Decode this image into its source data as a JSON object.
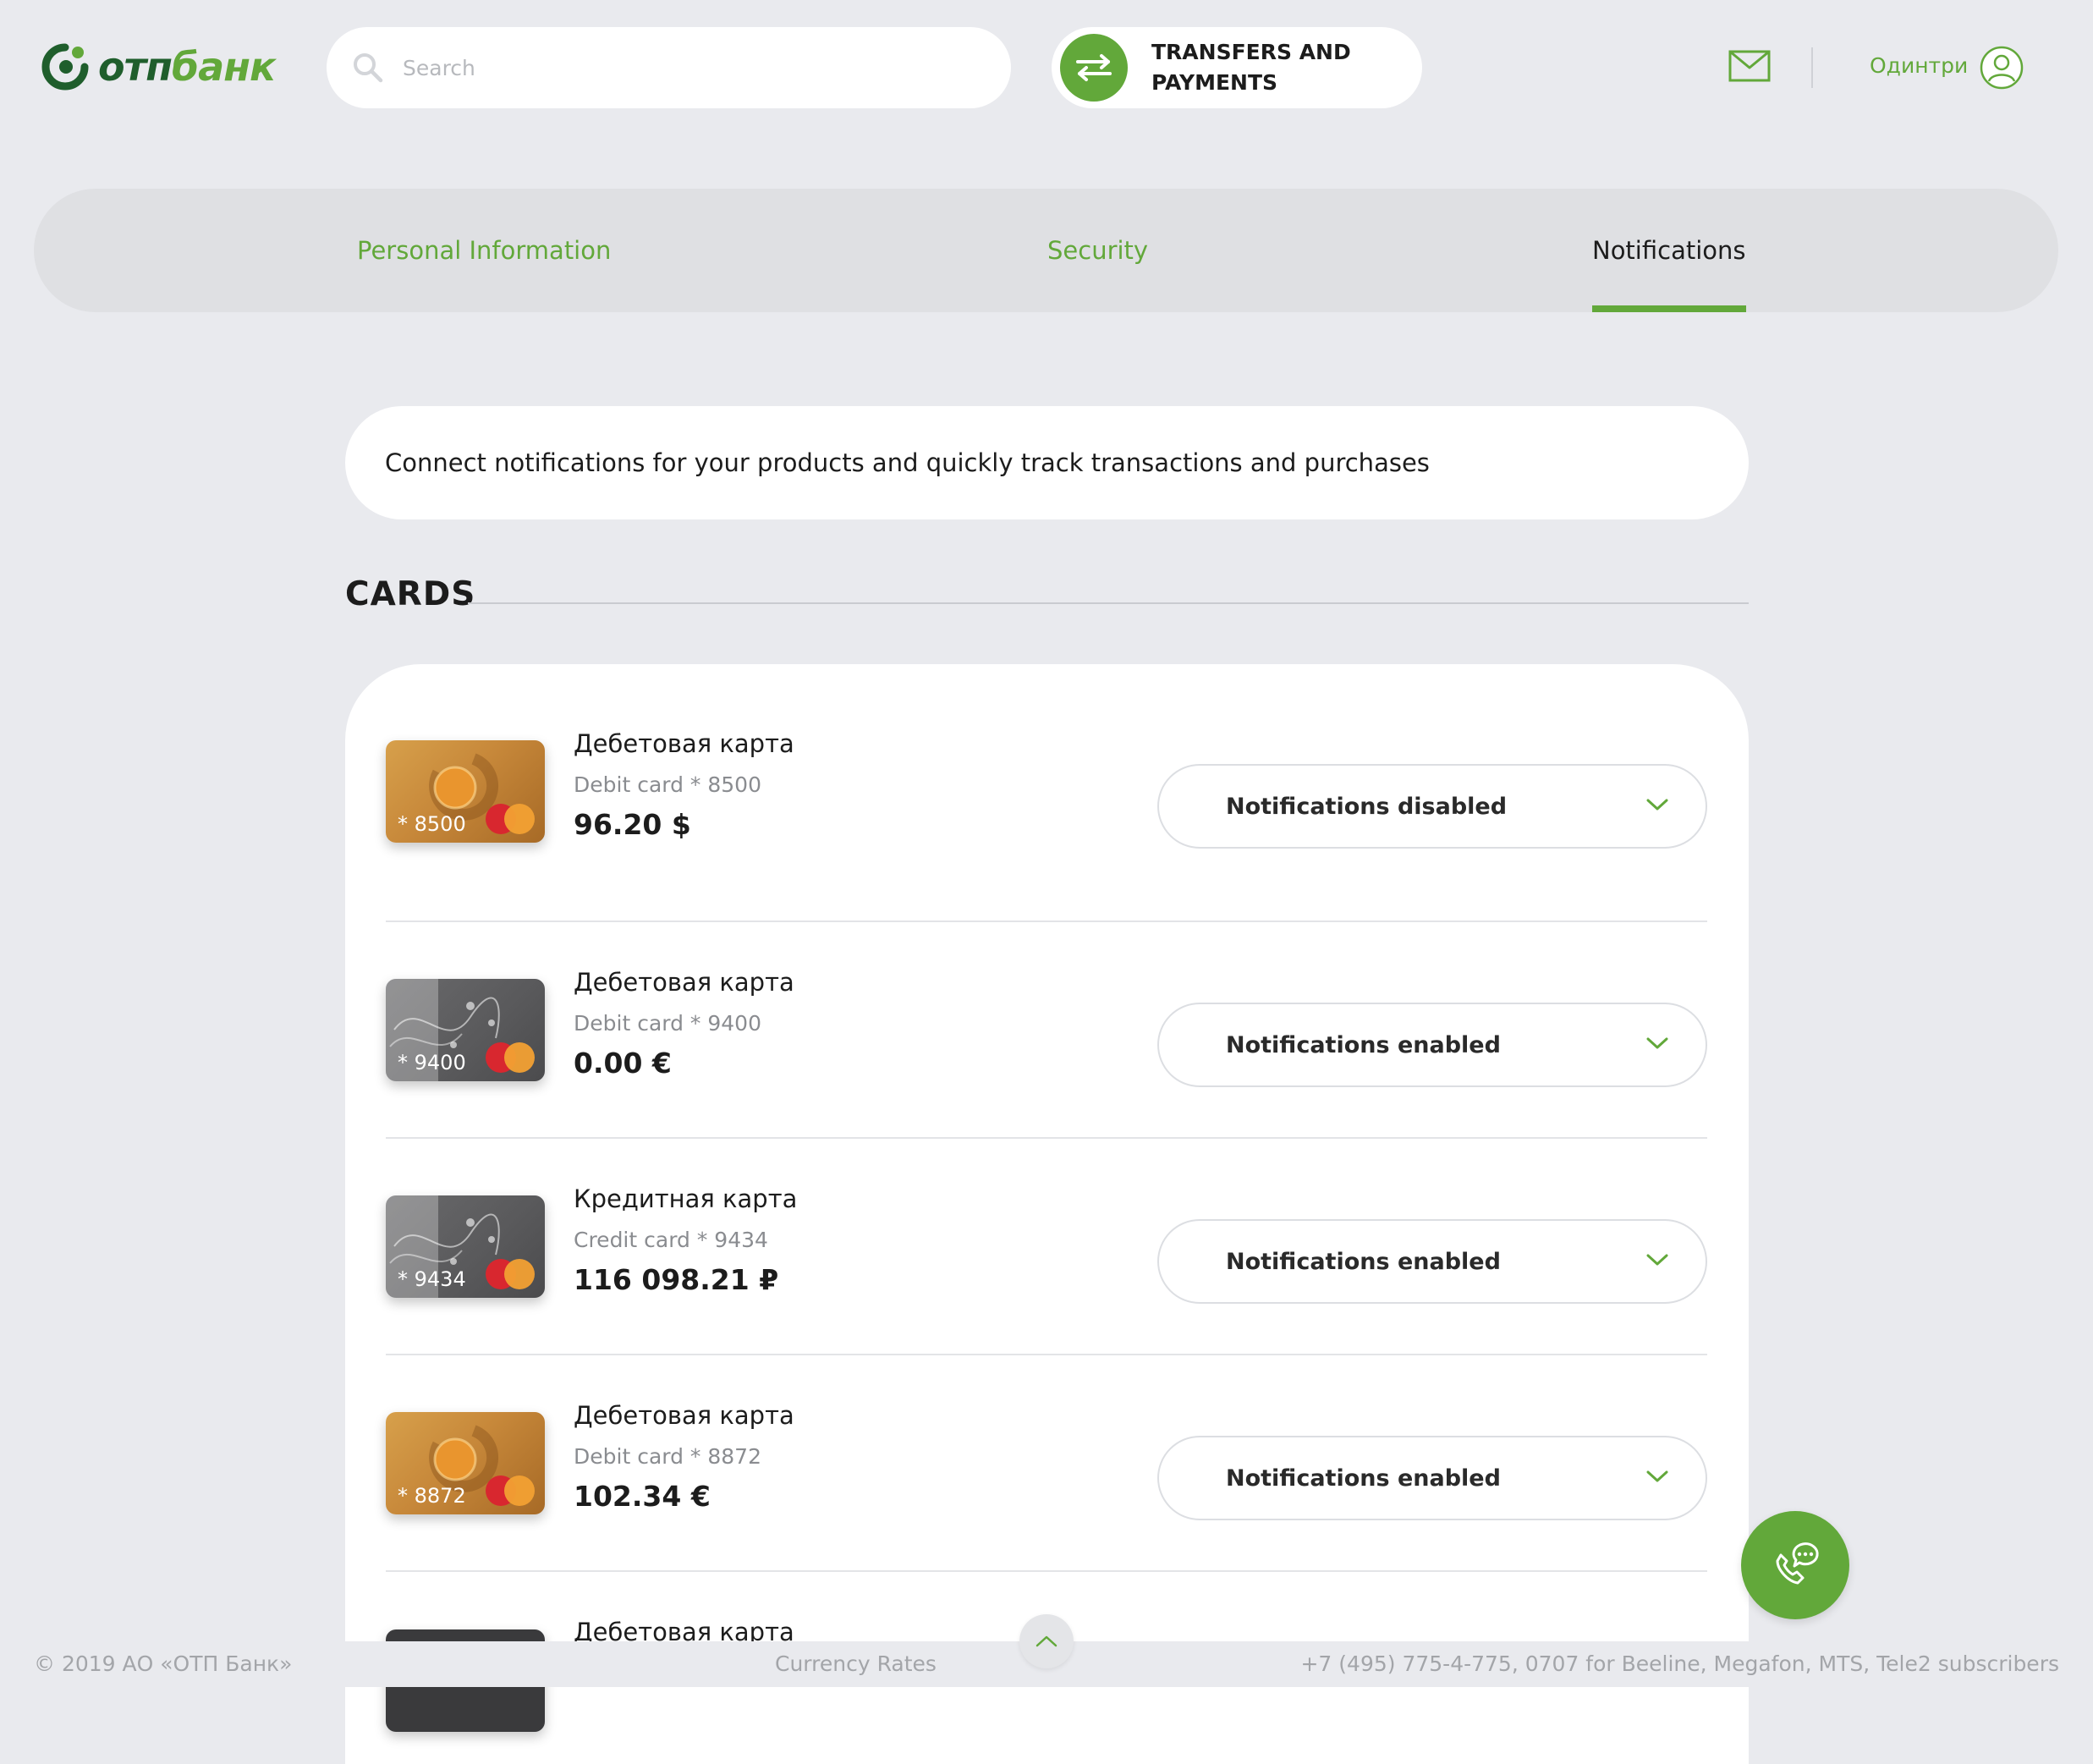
{
  "header": {
    "logo_text_main": "отп",
    "logo_text_accent": "банк",
    "search_placeholder": "Search",
    "transfers_label": "TRANSFERS AND PAYMENTS",
    "username": "Одинтри",
    "brand_color": "#62a83a"
  },
  "tabs": [
    {
      "label": "Personal Information",
      "active": false
    },
    {
      "label": "Security",
      "active": false
    },
    {
      "label": "Notifications",
      "active": true
    }
  ],
  "banner": "Connect notifications for your products and quickly track transactions and purchases",
  "section_title": "CARDS",
  "cards": [
    {
      "name": "Дебетовая карта",
      "subtitle": "Debit card * 8500",
      "amount": "96.20 $",
      "card_number": "* 8500",
      "style": "gold",
      "notification_status": "Notifications disabled"
    },
    {
      "name": "Дебетовая карта",
      "subtitle": "Debit card * 9400",
      "amount": "0.00 €",
      "card_number": "* 9400",
      "style": "grey",
      "notification_status": "Notifications enabled"
    },
    {
      "name": "Кредитная карта",
      "subtitle": "Credit card * 9434",
      "amount": "116 098.21 ₽",
      "card_number": "* 9434",
      "style": "grey",
      "notification_status": "Notifications enabled"
    },
    {
      "name": "Дебетовая карта",
      "subtitle": "Debit card * 8872",
      "amount": "102.34 €",
      "card_number": "* 8872",
      "style": "gold",
      "notification_status": "Notifications enabled"
    },
    {
      "name": "Дебетовая карта",
      "style": "dark"
    }
  ],
  "footer": {
    "copyright": "© 2019 АО «ОТП Банк»",
    "currency_rates": "Currency Rates",
    "phones": "+7 (495) 775-4-775,  0707 for Beeline, Megafon, MTS, Tele2 subscribers"
  }
}
